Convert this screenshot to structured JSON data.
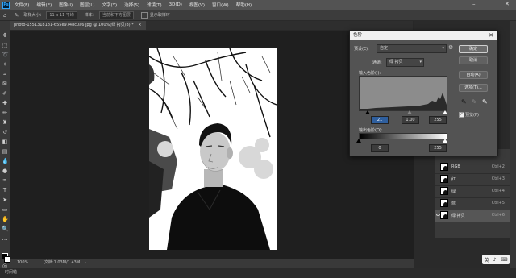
{
  "menubar": {
    "items": [
      "文件(F)",
      "编辑(E)",
      "图像(I)",
      "图层(L)",
      "文字(Y)",
      "选择(S)",
      "滤镜(T)",
      "3D(D)",
      "视图(V)",
      "窗口(W)",
      "帮助(H)"
    ],
    "window_controls": [
      "–",
      "□",
      "✕"
    ]
  },
  "options": {
    "sample_size_label": "取样大小：",
    "sample_size_value": "11 x 11 平均",
    "sample_label": "样本：",
    "sample_value": "当前和下方图层",
    "show_ring_label": "显示取样环"
  },
  "document": {
    "tab_title": "photo-1551318181-655e9748c0a6.jpg @ 100%(绿 拷贝/8) *",
    "zoom": "100%",
    "doc_info": "文档:1.03M/1.43M"
  },
  "bottom_panel": {
    "timeline_label": "时间轴"
  },
  "levels": {
    "title": "色阶",
    "preset_label": "预设(E):",
    "preset_value": "自定",
    "channel_label": "通道:",
    "channel_value": "绿 拷贝",
    "input_levels_label": "输入色阶(I):",
    "input_values": [
      "21",
      "1.00",
      "255"
    ],
    "output_levels_label": "输出色阶(O):",
    "output_values": [
      "0",
      "255"
    ],
    "buttons": {
      "ok": "确定",
      "cancel": "取消",
      "auto": "自动(A)",
      "options": "选项(T)..."
    },
    "preview_label": "预览(P)",
    "preview_checked": true
  },
  "channels": [
    {
      "name": "RGB",
      "shortcut": "Ctrl+2",
      "selected": false
    },
    {
      "name": "红",
      "shortcut": "Ctrl+3",
      "selected": false
    },
    {
      "name": "绿",
      "shortcut": "Ctrl+4",
      "selected": false
    },
    {
      "name": "蓝",
      "shortcut": "Ctrl+5",
      "selected": false
    },
    {
      "name": "绿 拷贝",
      "shortcut": "Ctrl+6",
      "selected": true
    }
  ],
  "mini_toolbar": [
    "英",
    "♪",
    "⌨"
  ],
  "colors": {
    "accent": "#31a8ff",
    "dialog_bg": "#535353",
    "canvas_bg": "#1f1f1f"
  }
}
